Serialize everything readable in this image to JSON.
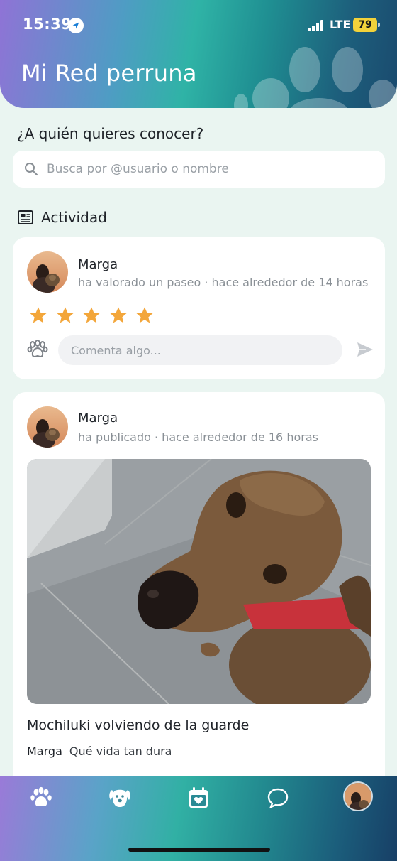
{
  "status_bar": {
    "time": "15:39",
    "network": "LTE",
    "battery": "79",
    "location_icon": "location-arrow-icon",
    "signal_icon": "signal-bars-icon"
  },
  "header": {
    "title": "Mi Red perruna"
  },
  "search": {
    "heading": "¿A quién quieres conocer?",
    "placeholder": "Busca por @usuario o nombre"
  },
  "activity": {
    "title": "Actividad",
    "icon": "newspaper-icon"
  },
  "feed": [
    {
      "user": "Marga",
      "action": "ha valorado un paseo · hace alrededor de 14 horas",
      "rating": 5,
      "comment_placeholder": "Comenta algo..."
    },
    {
      "user": "Marga",
      "action": "ha publicado · hace alrededor de 16 horas",
      "caption": "Mochiluki volviendo de la guarde",
      "comments": [
        {
          "user": "Marga",
          "text": "Qué vida tan dura"
        }
      ]
    }
  ],
  "colors": {
    "accent_star": "#f3a63a",
    "background": "#eaf5f1",
    "header_gradient_start": "#8f73d6",
    "header_gradient_end": "#1a4a6e"
  },
  "tabbar": {
    "items": [
      {
        "name": "paw-icon"
      },
      {
        "name": "dog-face-icon"
      },
      {
        "name": "calendar-heart-icon"
      },
      {
        "name": "chat-bubble-icon"
      },
      {
        "name": "profile-avatar"
      }
    ]
  }
}
